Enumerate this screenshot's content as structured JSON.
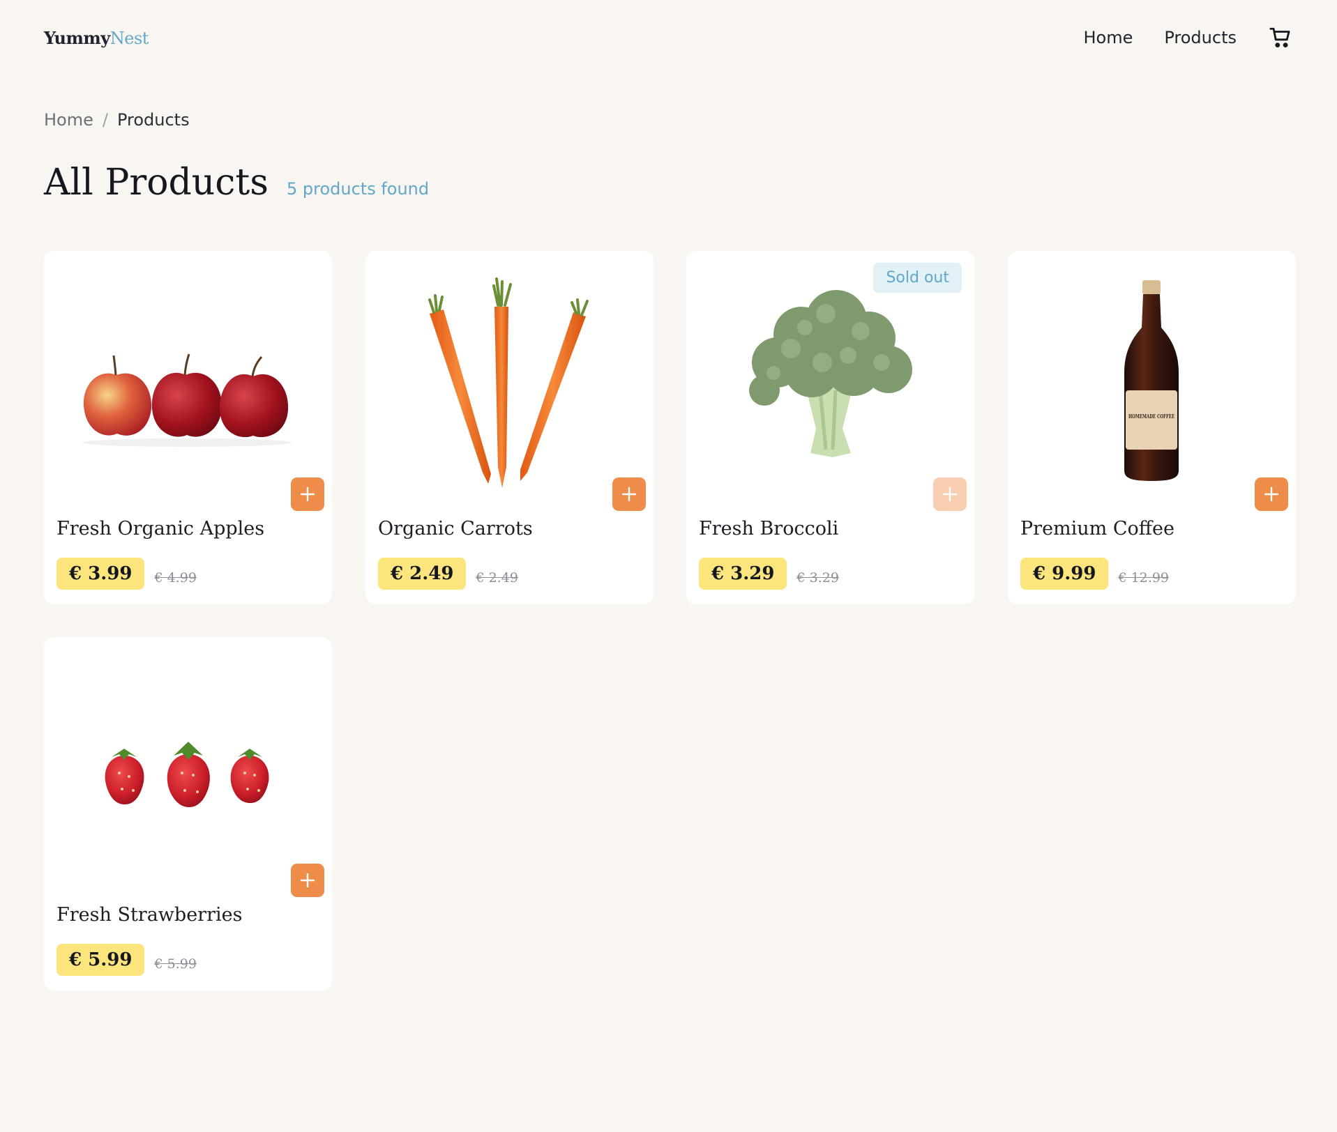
{
  "header": {
    "logo_part1": "Yummy",
    "logo_part2": "Nest",
    "nav": [
      {
        "label": "Home"
      },
      {
        "label": "Products"
      }
    ],
    "cart_icon": "shopping-cart-icon"
  },
  "breadcrumb": {
    "home": "Home",
    "separator": "/",
    "current": "Products"
  },
  "page": {
    "title": "All Products",
    "count": "5 products found"
  },
  "colors": {
    "background": "#f9f6f1",
    "accent_blue": "#5fa7cb",
    "add_button": "#ee8d4a",
    "add_button_disabled": "#f8cfb0",
    "price_badge": "#fde57e"
  },
  "products": [
    {
      "name": "Fresh Organic Apples",
      "price": "€ 3.99",
      "old_price": "€ 4.99",
      "image": "apples",
      "badge": "",
      "available": true
    },
    {
      "name": "Organic Carrots",
      "price": "€ 2.49",
      "old_price": "€ 2.49",
      "image": "carrots",
      "badge": "",
      "available": true
    },
    {
      "name": "Fresh Broccoli",
      "price": "€ 3.29",
      "old_price": "€ 3.29",
      "image": "broccoli",
      "badge": "Sold out",
      "available": false
    },
    {
      "name": "Premium Coffee",
      "price": "€ 9.99",
      "old_price": "€ 12.99",
      "image": "coffee-bottle",
      "image_label": "HOMEMADE COFFEE",
      "badge": "",
      "available": true
    },
    {
      "name": "Fresh Strawberries",
      "price": "€ 5.99",
      "old_price": "€ 5.99",
      "image": "strawberries",
      "badge": "",
      "available": true
    }
  ]
}
